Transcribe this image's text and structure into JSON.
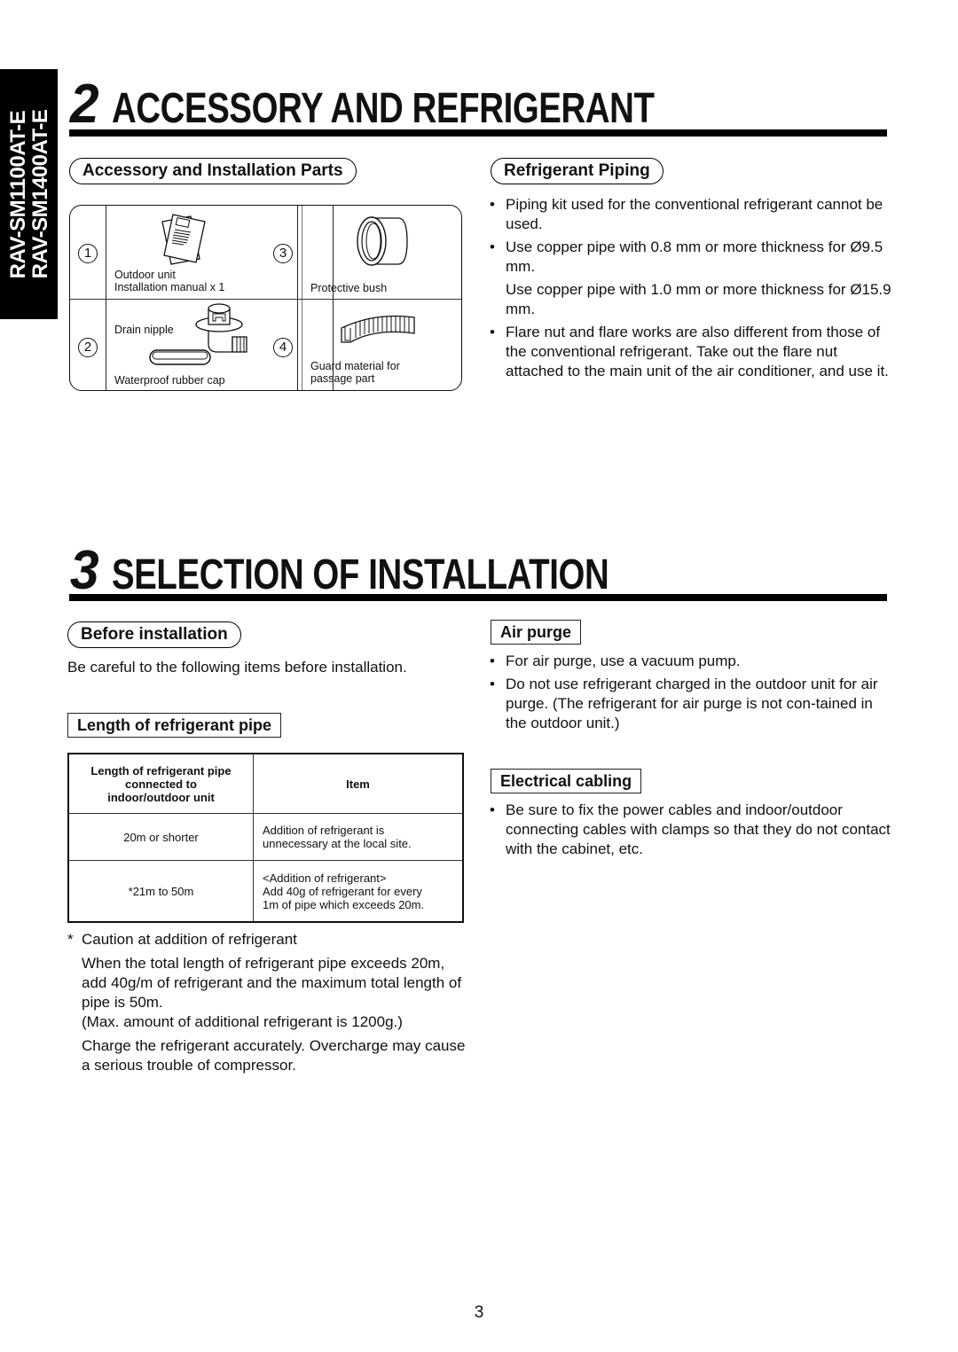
{
  "sidebar": {
    "models": [
      "RAV-SM1100AT-E",
      "RAV-SM1400AT-E"
    ]
  },
  "chapter2": {
    "number": "2",
    "title": "ACCESSORY AND REFRIGERANT"
  },
  "accessory": {
    "heading": "Accessory and Installation Parts",
    "parts": [
      {
        "number": "1",
        "icon": "manual-icon",
        "label_lines": [
          "Outdoor unit",
          "Installation manual x 1"
        ]
      },
      {
        "number": "2",
        "icon": "drain-nipple-icon",
        "label_top": "Drain nipple",
        "label_bottom": "Waterproof rubber cap"
      },
      {
        "number": "3",
        "icon": "protective-bush-icon",
        "label_lines": [
          "Protective bush"
        ]
      },
      {
        "number": "4",
        "icon": "guard-material-icon",
        "label_lines": [
          "Guard material for",
          "passage part"
        ]
      }
    ]
  },
  "refrigerant_piping": {
    "heading": "Refrigerant Piping",
    "bullet_symbol": "•",
    "items": [
      {
        "text": "Piping kit used for the conventional refrigerant cannot be used."
      },
      {
        "text": "Use copper pipe with 0.8 mm or more thickness for Ø9.5 mm.",
        "sub": "Use copper pipe with 1.0 mm or more thickness for Ø15.9 mm."
      },
      {
        "text": "Flare nut and flare works are also different from those of the conventional refrigerant.  Take out the flare nut attached to the main unit of the air conditioner, and use it."
      }
    ]
  },
  "chapter3": {
    "number": "3",
    "title": "SELECTION OF INSTALLATION"
  },
  "before_installation": {
    "heading": "Before installation",
    "intro": "Be careful to the following items before installation."
  },
  "pipe_length": {
    "heading": "Length of refrigerant pipe",
    "table": {
      "headers": [
        "Length of refrigerant pipe connected to indoor/outdoor unit",
        "Item"
      ],
      "header_lines": [
        "Length of refrigerant pipe",
        "connected to",
        "indoor/outdoor unit"
      ],
      "rows": [
        {
          "length": "20m or shorter",
          "item_lines": [
            "Addition of refrigerant is",
            "unnecessary at the local site."
          ]
        },
        {
          "length": "*21m to 50m",
          "item_lines": [
            "<Addition of refrigerant>",
            "Add 40g of refrigerant for every",
            "1m of pipe which exceeds 20m."
          ]
        }
      ]
    },
    "caution": {
      "marker": "*",
      "title": "Caution at addition of refrigerant",
      "paragraphs": [
        "When the total length of refrigerant pipe exceeds 20m, add 40g/m of refrigerant and the maximum total length of pipe is 50m.",
        "(Max. amount of additional refrigerant is 1200g.)",
        "Charge the refrigerant accurately. Overcharge may cause a serious trouble of compressor."
      ]
    }
  },
  "air_purge": {
    "heading": "Air purge",
    "items": [
      "For air purge, use a vacuum pump.",
      "Do not use refrigerant charged in the outdoor unit for air purge. (The refrigerant for air purge is not con-tained in the outdoor unit.)"
    ]
  },
  "electrical_cabling": {
    "heading": "Electrical cabling",
    "items": [
      "Be sure to fix the power cables and indoor/outdoor connecting cables with clamps so that they do not contact with the cabinet, etc."
    ]
  },
  "page_number": "3"
}
